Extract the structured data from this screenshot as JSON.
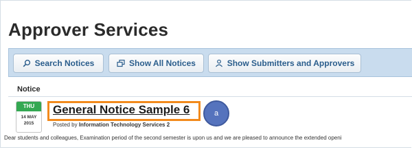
{
  "page": {
    "title": "Approver Services"
  },
  "toolbar": {
    "search_label": "Search Notices",
    "show_all_label": "Show All Notices",
    "submitters_label": "Show Submitters and Approvers"
  },
  "notices": {
    "column_header": "Notice",
    "item": {
      "day_of_week": "THU",
      "day_month": "14 MAY",
      "year": "2015",
      "title": "General Notice Sample 6",
      "posted_by_prefix": "Posted by",
      "author": "Information Technology Services 2",
      "excerpt": "Dear students and colleagues, Examination period of the second semester is upon us and we are pleased to announce the extended openi"
    }
  },
  "annotation": {
    "marker_label": "a",
    "highlight_color": "#f28a1c",
    "marker_color": "#5573bd"
  },
  "colors": {
    "toolbar_bg": "#c9dcee",
    "button_text": "#2a5d8c",
    "date_header": "#34a852"
  },
  "icons": {
    "search": "search-icon",
    "show_all": "stack-icon",
    "submitters": "person-icon"
  }
}
